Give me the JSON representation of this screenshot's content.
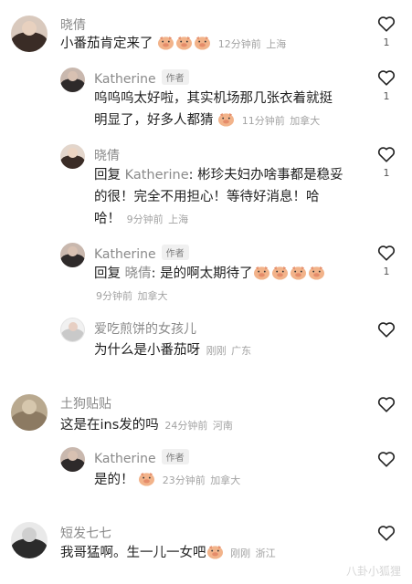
{
  "comments": [
    {
      "user": "晓倩",
      "text": "小番茄肯定来了",
      "time": "12分钟前",
      "loc": "上海",
      "likes": "1"
    },
    {
      "user": "Katherine",
      "badge": "作者",
      "text_line1": "呜呜呜太好啦，其实机场那几张衣着就挺",
      "text_line2": "明显了，好多人都猜",
      "time": "11分钟前",
      "loc": "加拿大",
      "likes": "1"
    },
    {
      "user": "晓倩",
      "prefix": "回复",
      "reply_to": "Katherine",
      "text_line1": ": 彬珍夫妇办啥事都是稳妥",
      "text_line2": "的很！完全不用担心！等待好消息！哈",
      "text_line3": "哈！",
      "time": "9分钟前",
      "loc": "上海",
      "likes": "1"
    },
    {
      "user": "Katherine",
      "badge": "作者",
      "prefix": "回复",
      "reply_to": "晓倩",
      "text": ": 是的啊太期待了",
      "time": "9分钟前",
      "loc": "加拿大",
      "likes": "1"
    },
    {
      "user": "爱吃煎饼的女孩儿",
      "text": "为什么是小番茄呀",
      "time": "刚刚",
      "loc": "广东"
    },
    {
      "user": "土狗贴贴",
      "text": "这是在ins发的吗",
      "time": "24分钟前",
      "loc": "河南"
    },
    {
      "user": "Katherine",
      "badge": "作者",
      "text": "是的！",
      "time": "23分钟前",
      "loc": "加拿大"
    },
    {
      "user": "短发七七",
      "text": "我哥猛啊。生一儿一女吧",
      "time": "刚刚",
      "loc": "浙江"
    }
  ],
  "watermark": "八卦小狐狸",
  "colors": {
    "emoji": "#f2b38a",
    "heart_stroke": "#222222",
    "meta": "#a3a3a3"
  },
  "icons": {
    "like": "heart-outline-icon",
    "emoji": "pig-face-emoji"
  }
}
